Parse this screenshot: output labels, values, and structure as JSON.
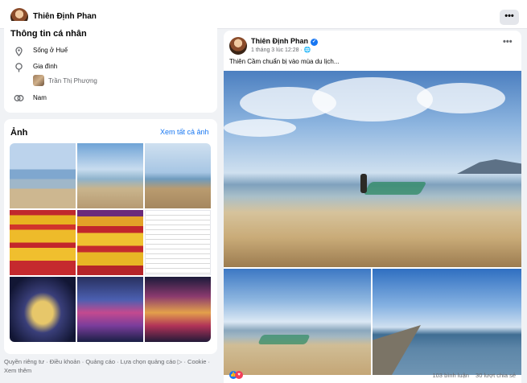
{
  "topbar": {
    "name": "Thiên Định Phan",
    "more": "•••"
  },
  "intro": {
    "title": "Thông tin cá nhân",
    "lives_in": "Sống ở Huế",
    "family_label": "Gia đình",
    "family_member": "Trần Thị Phượng",
    "gender": "Nam"
  },
  "photos": {
    "title": "Ảnh",
    "see_all": "Xem tất cả ảnh"
  },
  "footer": {
    "links": "Quyền riêng tư · Điều khoản · Quảng cáo · Lựa chọn quảng cáo ▷ · Cookie · Xem thêm"
  },
  "post": {
    "author": "Thiên Định Phan",
    "meta": "1 tháng 3 lúc 12:28 · 🌐",
    "more": "•••",
    "text": "Thiên Cầm chuẩn bị vào mùa du lịch...",
    "comments": "103 bình luận",
    "shares": "30 lượt chia sẻ"
  },
  "icons": {
    "location": "location-pin-icon",
    "family": "heart-pin-icon",
    "gender": "gender-icon",
    "verified": "verified-badge-icon",
    "like": "like-reaction-icon",
    "love": "love-reaction-icon"
  }
}
